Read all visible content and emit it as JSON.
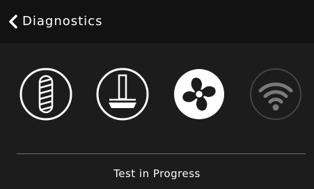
{
  "header": {
    "title": "Diagnostics",
    "back_icon": "chevron-left-icon"
  },
  "tests": [
    {
      "name": "extruder-screw",
      "icon": "extruder-screw-icon",
      "state": "active"
    },
    {
      "name": "build-plate",
      "icon": "build-plate-icon",
      "state": "active"
    },
    {
      "name": "fan",
      "icon": "fan-icon",
      "state": "active"
    },
    {
      "name": "wifi",
      "icon": "wifi-icon",
      "state": "pending"
    }
  ],
  "status": {
    "text": "Test in Progress"
  },
  "colors": {
    "background": "#1c1c1c",
    "header_background": "#121212",
    "active_icon": "#ffffff",
    "pending_icon": "#7a7a7a",
    "divider": "#6e6e6e"
  }
}
